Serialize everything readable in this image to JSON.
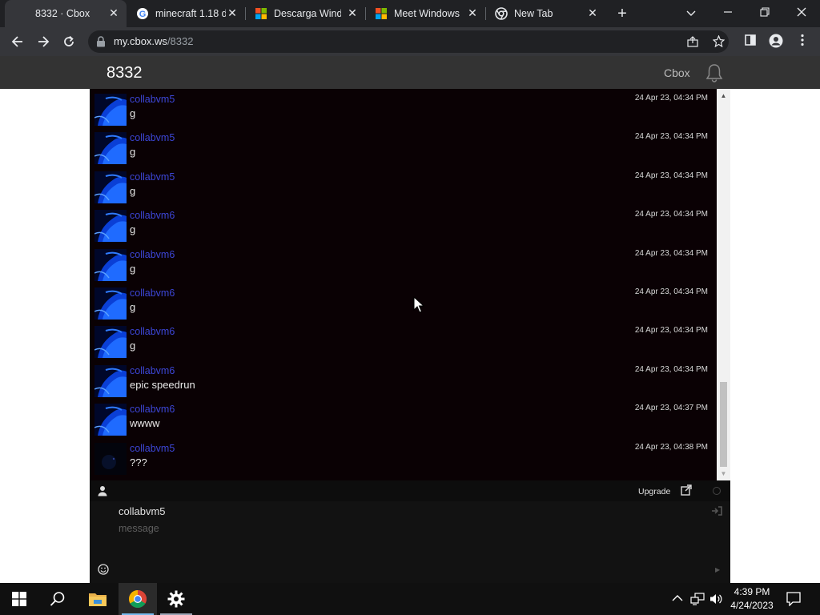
{
  "browser": {
    "tabs": [
      {
        "title": "8332 · Cbox",
        "active": true
      },
      {
        "title": "minecraft 1.18 d",
        "active": false
      },
      {
        "title": "Descarga Windo",
        "active": false
      },
      {
        "title": "Meet Windows",
        "active": false
      },
      {
        "title": "New Tab",
        "active": false
      }
    ],
    "url_host": "my.cbox.ws",
    "url_path": "/8332"
  },
  "cbox": {
    "title": "8332",
    "brand": "Cbox",
    "messages": [
      {
        "user": "collabvm5",
        "text": "g",
        "time": "24 Apr 23, 04:34 PM",
        "avatar": "blue"
      },
      {
        "user": "collabvm5",
        "text": "g",
        "time": "24 Apr 23, 04:34 PM",
        "avatar": "blue"
      },
      {
        "user": "collabvm5",
        "text": "g",
        "time": "24 Apr 23, 04:34 PM",
        "avatar": "blue"
      },
      {
        "user": "collabvm6",
        "text": "g",
        "time": "24 Apr 23, 04:34 PM",
        "avatar": "blue"
      },
      {
        "user": "collabvm6",
        "text": "g",
        "time": "24 Apr 23, 04:34 PM",
        "avatar": "blue"
      },
      {
        "user": "collabvm6",
        "text": "g",
        "time": "24 Apr 23, 04:34 PM",
        "avatar": "blue"
      },
      {
        "user": "collabvm6",
        "text": "g",
        "time": "24 Apr 23, 04:34 PM",
        "avatar": "blue"
      },
      {
        "user": "collabvm6",
        "text": "epic speedrun",
        "time": "24 Apr 23, 04:34 PM",
        "avatar": "blue"
      },
      {
        "user": "collabvm6",
        "text": "wwww",
        "time": "24 Apr 23, 04:37 PM",
        "avatar": "blue"
      },
      {
        "user": "collabvm5",
        "text": "???",
        "time": "24 Apr 23, 04:38 PM",
        "avatar": "dark"
      }
    ],
    "upgrade_label": "Upgrade",
    "compose_name": "collabvm5",
    "message_placeholder": "message"
  },
  "taskbar": {
    "time": "4:39 PM",
    "date": "4/24/2023"
  },
  "colors": {
    "username": "#3c46d6",
    "chat_bg": "#0a0104",
    "header_bg": "#333333"
  }
}
